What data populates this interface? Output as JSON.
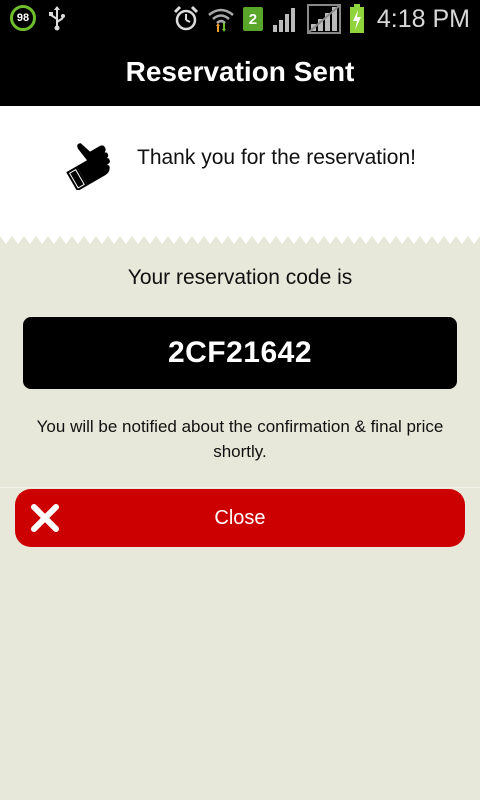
{
  "status_bar": {
    "battery_level": "98",
    "sim_slot": "2",
    "time": "4:18 PM",
    "icons": [
      "battery-ring-icon",
      "usb-icon",
      "alarm-icon",
      "wifi-icon",
      "signal-icon",
      "signal-icon-2",
      "battery-charging-icon"
    ]
  },
  "header": {
    "title": "Reservation Sent"
  },
  "thanks": {
    "icon": "thumbs-up-icon",
    "message": "Thank you for the reservation!"
  },
  "reservation": {
    "label": "Your reservation code is",
    "code": "2CF21642",
    "notice": "You will be notified about the confirmation & final price shortly."
  },
  "close_button": {
    "icon": "close-icon",
    "label": "Close"
  },
  "colors": {
    "background": "#e8e8da",
    "header": "#000000",
    "code_box": "#000000",
    "close_button": "#cc0000",
    "battery_ring": "#6fbf2c",
    "sim_badge": "#5aa62a"
  }
}
